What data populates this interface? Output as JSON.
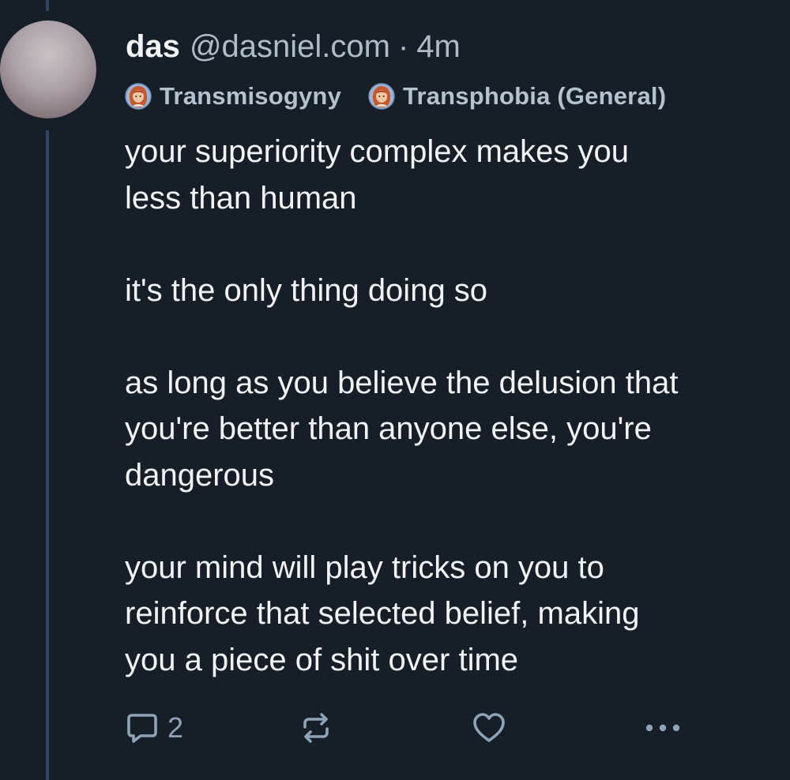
{
  "post": {
    "display_name": "das",
    "handle": "@dasniel.com",
    "separator": "·",
    "time": "4m",
    "labels": [
      {
        "text": "Transmisogyny",
        "icon": "labeler-avatar-icon"
      },
      {
        "text": "Transphobia (General)",
        "icon": "labeler-avatar-icon"
      }
    ],
    "text": "your superiority complex makes you\nless than human\n\nit's the only thing doing so\n\nas long as you believe the delusion that\nyou're better than anyone else, you're\ndangerous\n\nyour mind will play tricks on you to\nreinforce that selected belief, making\nyou a piece of shit over time",
    "actions": {
      "reply": {
        "icon": "reply-icon",
        "count": "2"
      },
      "repost": {
        "icon": "repost-icon"
      },
      "like": {
        "icon": "heart-icon"
      },
      "more": {
        "icon": "more-icon"
      }
    }
  },
  "colors": {
    "background": "#161e27",
    "thread_line": "#2e4863",
    "text": "#f1f3f5",
    "muted": "#aebbc9",
    "action": "#8ea3b8"
  }
}
